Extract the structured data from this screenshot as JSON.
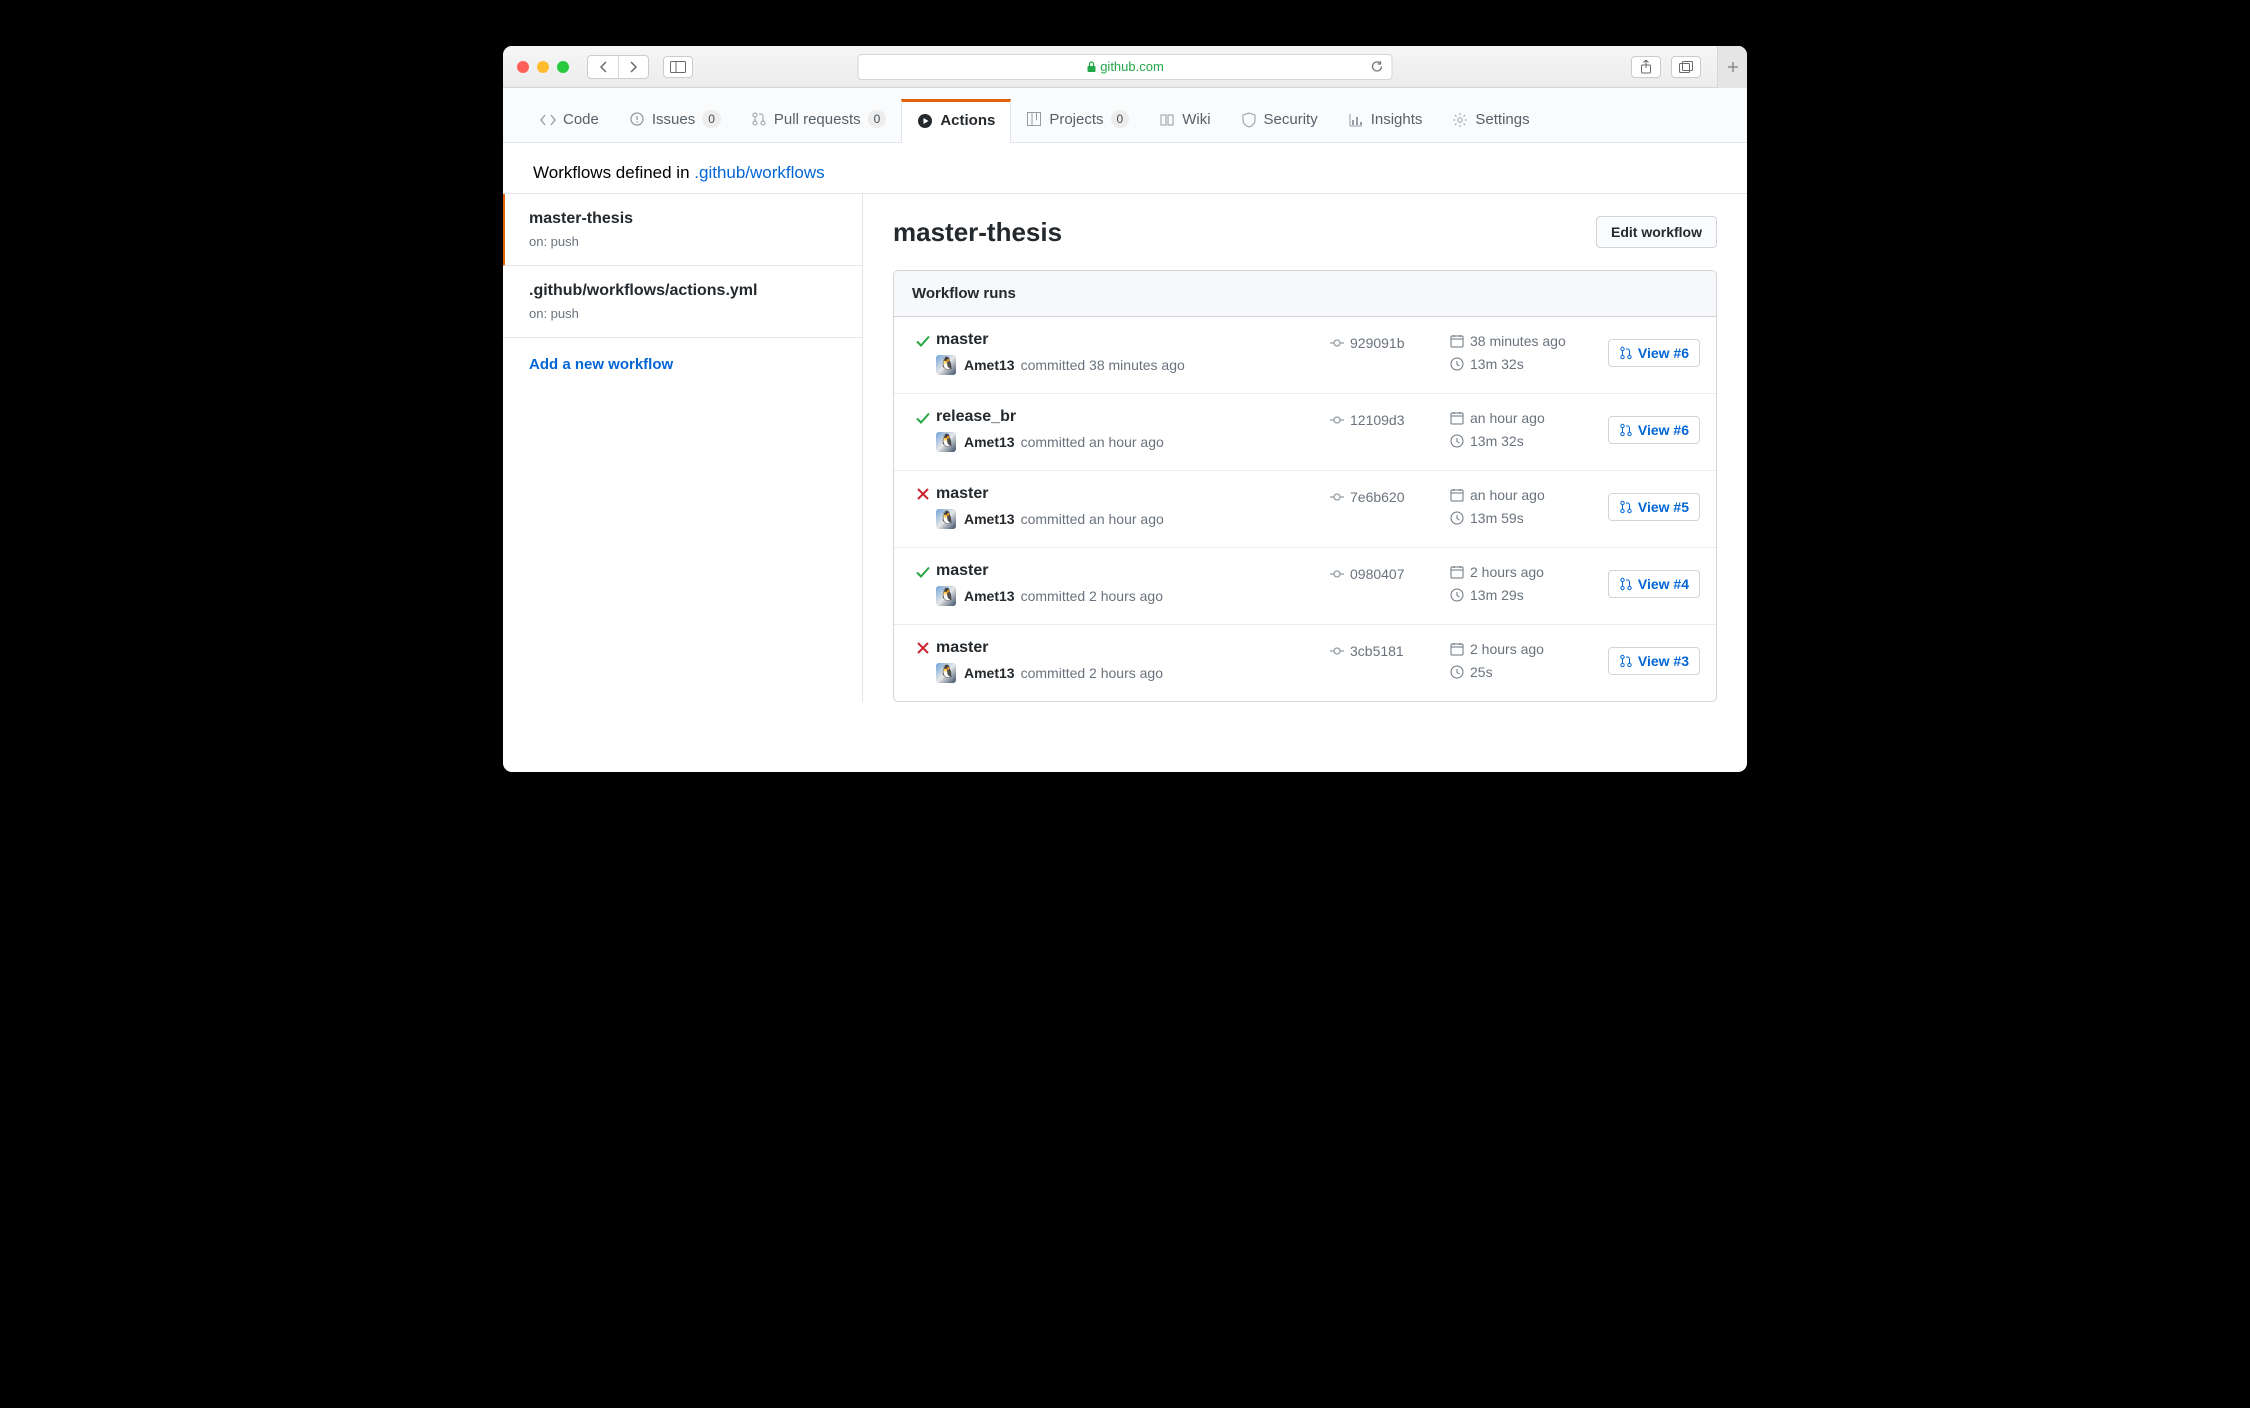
{
  "browser": {
    "url_domain": "github.com"
  },
  "repo_nav": {
    "code": "Code",
    "issues": {
      "label": "Issues",
      "count": "0"
    },
    "pulls": {
      "label": "Pull requests",
      "count": "0"
    },
    "actions": "Actions",
    "projects": {
      "label": "Projects",
      "count": "0"
    },
    "wiki": "Wiki",
    "security": "Security",
    "insights": "Insights",
    "settings": "Settings"
  },
  "subheader": {
    "prefix": "Workflows defined in ",
    "link": ".github/workflows"
  },
  "sidebar": {
    "items": [
      {
        "name": "master-thesis",
        "trigger": "on: push",
        "selected": true
      },
      {
        "name": ".github/workflows/actions.yml",
        "trigger": "on: push",
        "selected": false
      }
    ],
    "add_label": "Add a new workflow"
  },
  "main": {
    "title": "master-thesis",
    "edit_label": "Edit workflow",
    "runs_header": "Workflow runs",
    "runs": [
      {
        "status": "success",
        "branch": "master",
        "actor": "Amet13",
        "commit_time": "committed 38 minutes ago",
        "sha": "929091b",
        "started": "38 minutes ago",
        "duration": "13m 32s",
        "view": "View #6"
      },
      {
        "status": "success",
        "branch": "release_br",
        "actor": "Amet13",
        "commit_time": "committed an hour ago",
        "sha": "12109d3",
        "started": "an hour ago",
        "duration": "13m 32s",
        "view": "View #6"
      },
      {
        "status": "fail",
        "branch": "master",
        "actor": "Amet13",
        "commit_time": "committed an hour ago",
        "sha": "7e6b620",
        "started": "an hour ago",
        "duration": "13m 59s",
        "view": "View #5"
      },
      {
        "status": "success",
        "branch": "master",
        "actor": "Amet13",
        "commit_time": "committed 2 hours ago",
        "sha": "0980407",
        "started": "2 hours ago",
        "duration": "13m 29s",
        "view": "View #4"
      },
      {
        "status": "fail",
        "branch": "master",
        "actor": "Amet13",
        "commit_time": "committed 2 hours ago",
        "sha": "3cb5181",
        "started": "2 hours ago",
        "duration": "25s",
        "view": "View #3"
      }
    ]
  }
}
